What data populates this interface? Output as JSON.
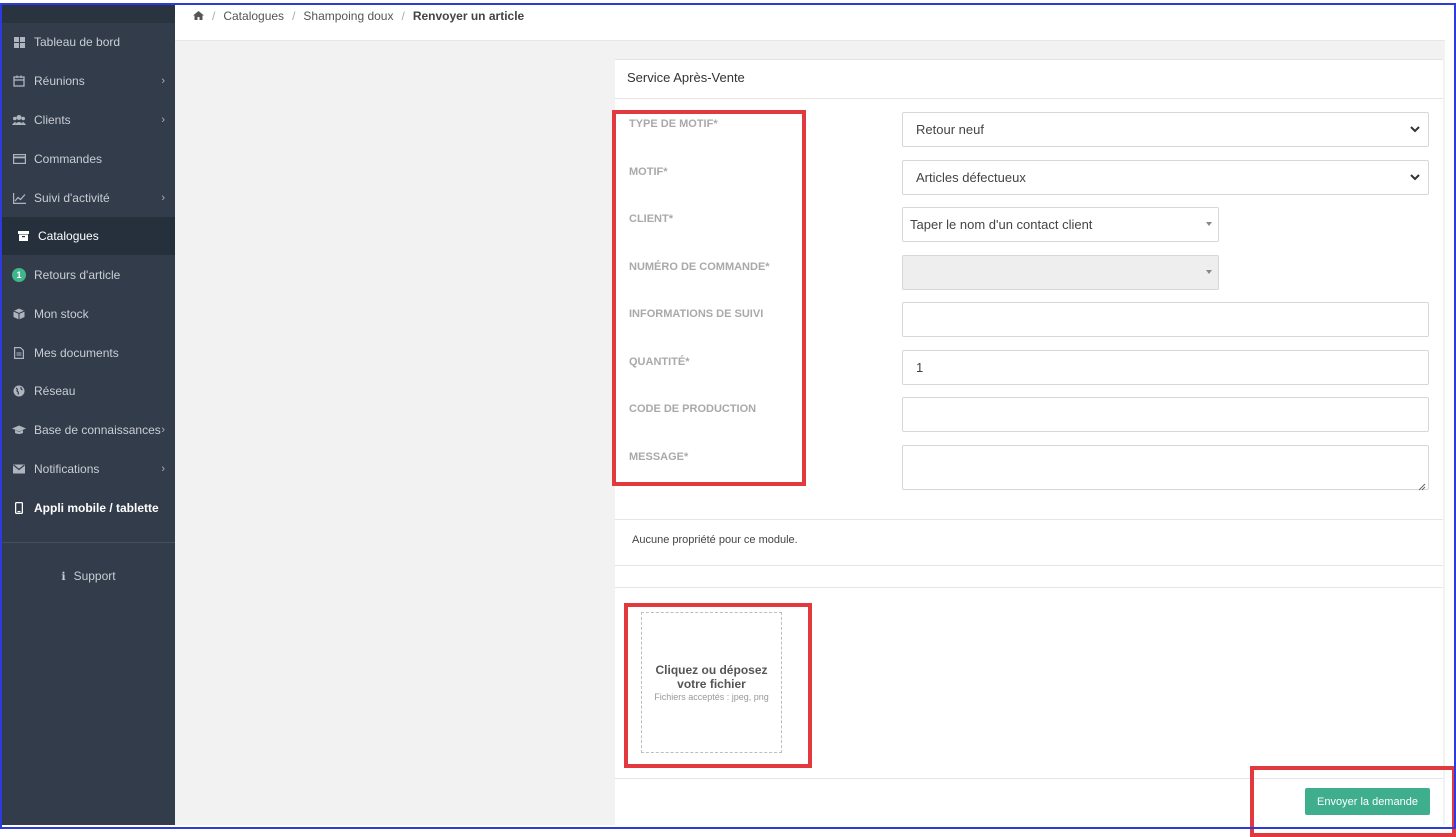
{
  "sidebar": {
    "items": [
      {
        "label": "Tableau de bord",
        "icon": "dashboard-icon",
        "chevron": false
      },
      {
        "label": "Réunions",
        "icon": "calendar-icon",
        "chevron": true
      },
      {
        "label": "Clients",
        "icon": "users-icon",
        "chevron": true
      },
      {
        "label": "Commandes",
        "icon": "credit-card-icon",
        "chevron": false
      },
      {
        "label": "Suivi d'activité",
        "icon": "line-chart-icon",
        "chevron": true
      },
      {
        "label": "Catalogues",
        "icon": "archive-icon",
        "chevron": false,
        "active": true
      },
      {
        "label": "Retours d'article",
        "icon": "badge",
        "badge": "1",
        "chevron": false
      },
      {
        "label": "Mon stock",
        "icon": "cube-icon",
        "chevron": false
      },
      {
        "label": "Mes documents",
        "icon": "document-icon",
        "chevron": false
      },
      {
        "label": "Réseau",
        "icon": "globe-icon",
        "chevron": false
      },
      {
        "label": "Base de connaissances",
        "icon": "graduation-cap-icon",
        "chevron": true
      },
      {
        "label": "Notifications",
        "icon": "envelope-icon",
        "chevron": true
      },
      {
        "label": "Appli mobile / tablette",
        "icon": "mobile-icon",
        "chevron": false
      }
    ],
    "support": "Support"
  },
  "breadcrumb": {
    "items": [
      "Catalogues",
      "Shampoing doux"
    ],
    "current": "Renvoyer un article"
  },
  "panel": {
    "title": "Service Après-Vente",
    "labels": {
      "motif_type": "TYPE DE MOTIF*",
      "motif": "MOTIF*",
      "client": "CLIENT*",
      "order_number": "NUMÉRO DE COMMANDE*",
      "tracking": "INFORMATIONS DE SUIVI",
      "quantity": "QUANTITÉ*",
      "production_code": "CODE DE PRODUCTION",
      "message": "MESSAGE*"
    },
    "values": {
      "motif_type": "Retour neuf",
      "motif": "Articles défectueux",
      "client": "Taper le nom d'un contact client",
      "order_number": "",
      "tracking": "",
      "quantity": "1",
      "production_code": "",
      "message": ""
    },
    "no_properties": "Aucune propriété pour ce module.",
    "dropzone": {
      "title": "Cliquez ou déposez votre fichier",
      "subtitle": "Fichiers acceptés : jpeg, png"
    },
    "submit_label": "Envoyer la demande"
  },
  "colors": {
    "sidebar_bg": "#323c4a",
    "accent_green": "#3fae8c",
    "highlight_red": "#e1393e",
    "frame_blue": "#2b3be0"
  }
}
